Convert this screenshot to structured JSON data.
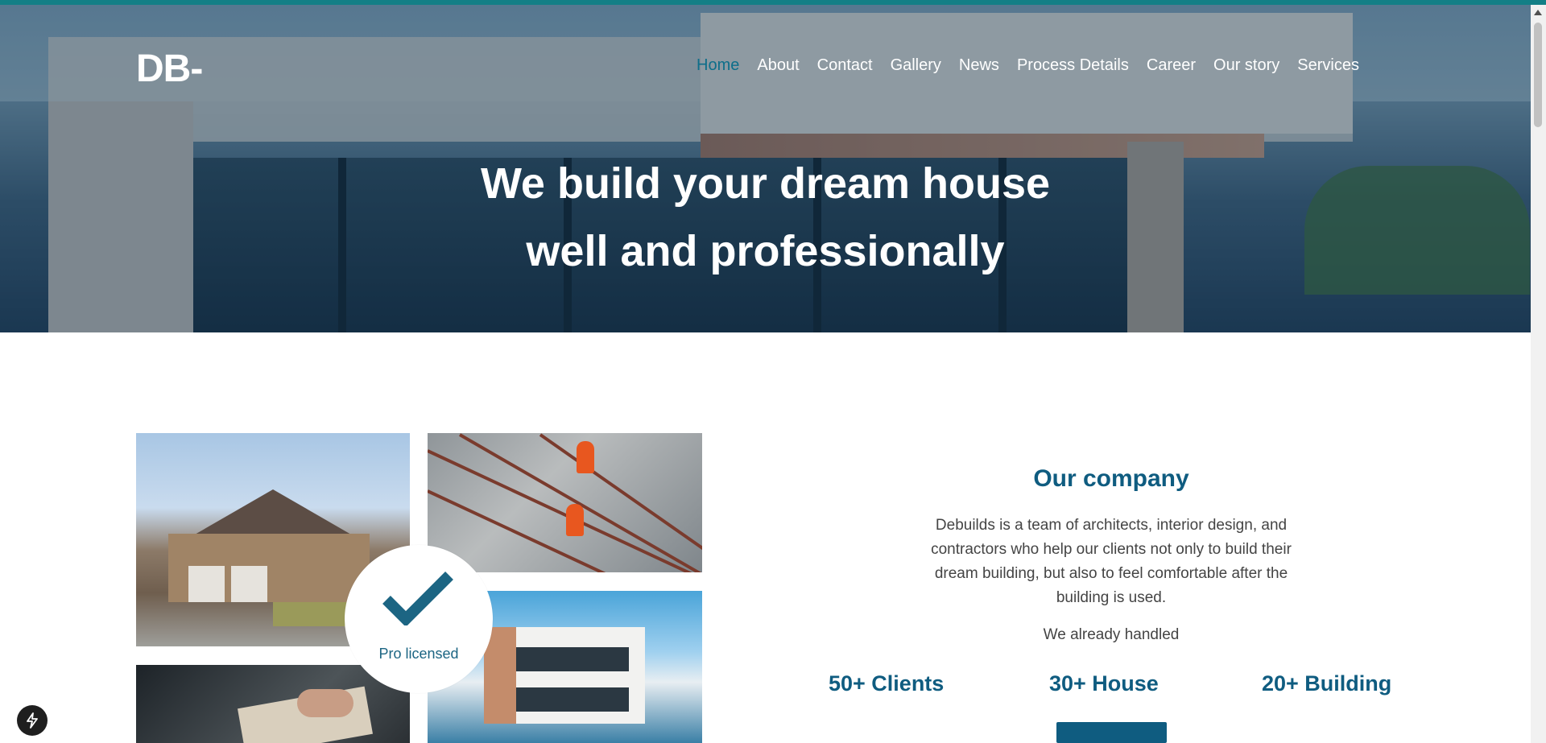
{
  "header": {
    "logo": "DB-",
    "nav": [
      {
        "label": "Home",
        "active": true
      },
      {
        "label": "About"
      },
      {
        "label": "Contact"
      },
      {
        "label": "Gallery"
      },
      {
        "label": "News"
      },
      {
        "label": "Process Details"
      },
      {
        "label": "Career"
      },
      {
        "label": "Our story"
      },
      {
        "label": "Services"
      }
    ]
  },
  "hero": {
    "title_line1": "We build your dream house",
    "title_line2": "well and professionally"
  },
  "badge": {
    "label": "Pro licensed",
    "icon": "check-icon"
  },
  "company": {
    "title": "Our company",
    "description": "Debuilds is a team of architects, interior design, and contractors who help our clients not only to build their dream building, but also to feel comfortable after the building is used.",
    "handled_label": "We already handled",
    "stats": [
      "50+ Clients",
      "30+ House",
      "20+ Building"
    ]
  },
  "colors": {
    "accent": "#0f5c80",
    "top_bar": "#137f86",
    "nav_active": "#0d6e8a"
  },
  "floating_button": {
    "icon": "bolt-icon"
  }
}
